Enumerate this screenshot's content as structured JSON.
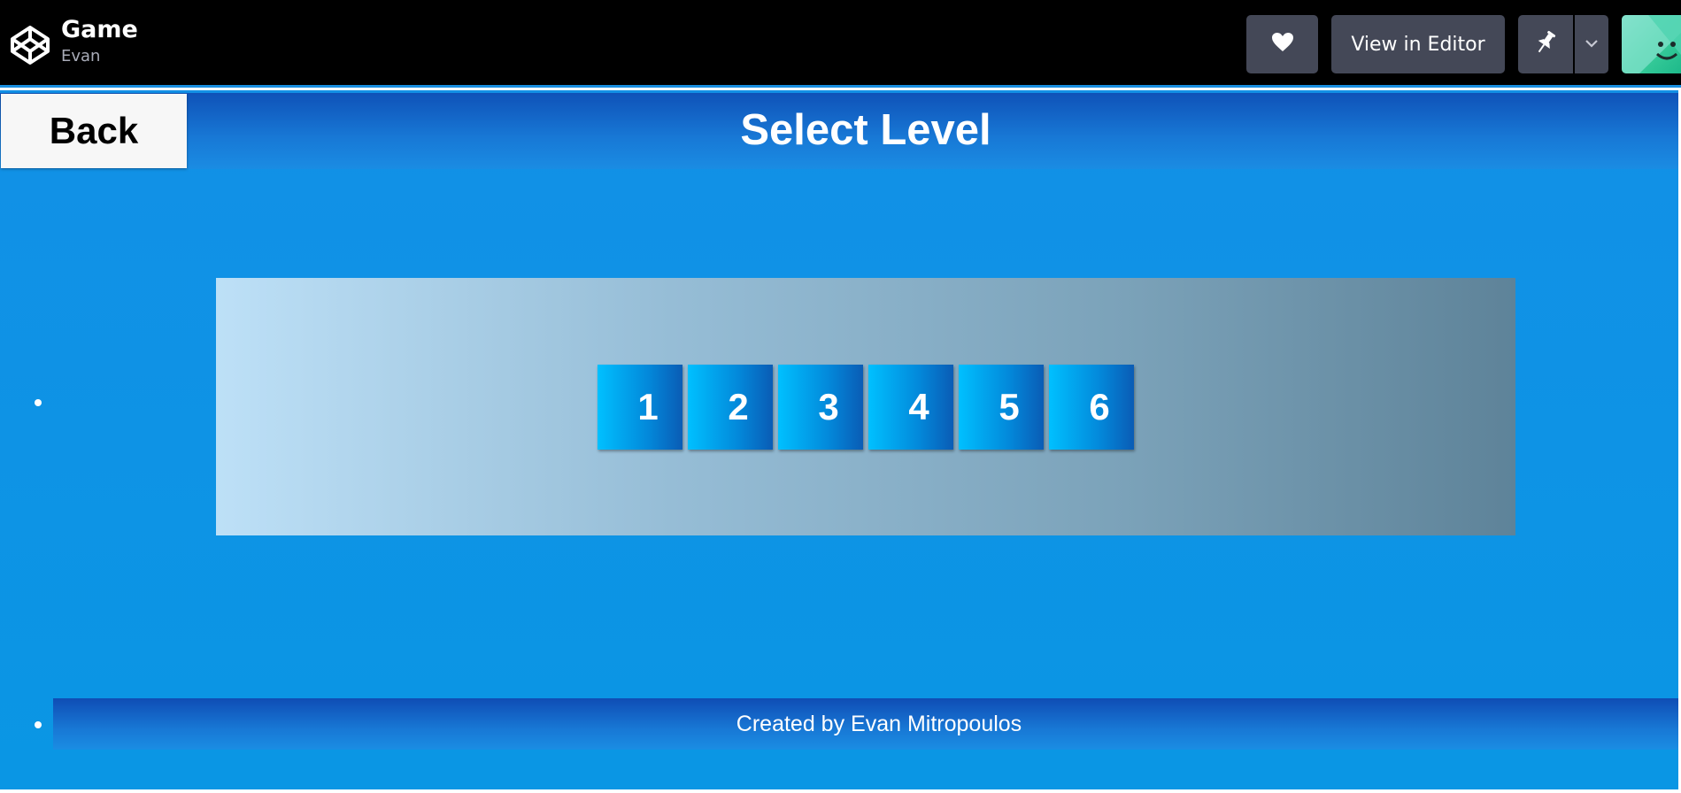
{
  "topbar": {
    "title": "Game",
    "author": "Evan",
    "editor_label": "View in Editor",
    "icons": {
      "logo": "codepen-cube-icon",
      "heart": "heart-icon",
      "pin": "pin-icon",
      "chevron": "chevron-down-icon",
      "avatar": "avatar-smiley"
    }
  },
  "game": {
    "back_label": "Back",
    "title": "Select Level",
    "levels": [
      "1",
      "2",
      "3",
      "4",
      "5",
      "6"
    ],
    "footer": "Created by Evan Mitropoulos"
  },
  "colors": {
    "topbar_bg": "#000000",
    "button_bg": "#444857",
    "page_bg": "#1290e6",
    "band": "#0f52b8",
    "level_button": "#00c0ff"
  }
}
